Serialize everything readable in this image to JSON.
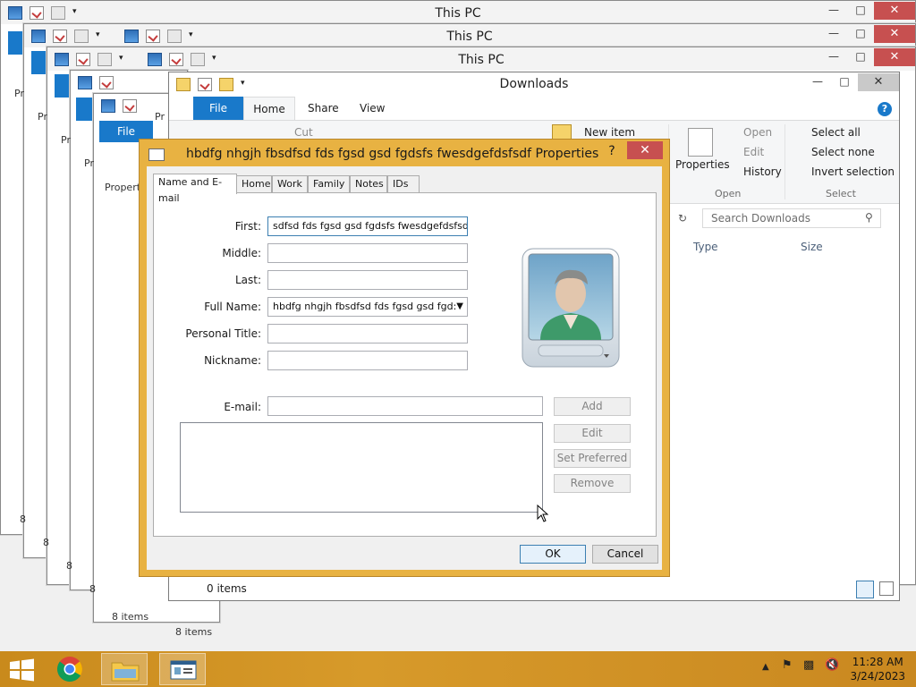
{
  "background_windows": [
    {
      "title": "This PC"
    },
    {
      "title": "This PC"
    },
    {
      "title": "This PC"
    }
  ],
  "fragments": {
    "pr1": "Pr",
    "pr2": "Pr",
    "pr3": "Pr",
    "pr4": "Pr",
    "pr5": "Pr",
    "n1": "8",
    "n2": "8",
    "n3": "8",
    "n4": "8",
    "file_tab": "File",
    "propert": "Propert",
    "items_8": "8 items",
    "items_8b": "8 items"
  },
  "downloads": {
    "title": "Downloads",
    "tabs": [
      "File",
      "Home",
      "Share",
      "View"
    ],
    "ribbon": {
      "cut": "Cut",
      "new_item": "New item",
      "open": "Open",
      "edit": "Edit",
      "history": "History",
      "properties": "Properties",
      "select_all": "Select all",
      "select_none": "Select none",
      "invert_selection": "Invert selection",
      "group_open": "Open",
      "group_select": "Select"
    },
    "search_placeholder": "Search Downloads",
    "columns": [
      "Type",
      "Size"
    ],
    "status": "0 items"
  },
  "dialog": {
    "title": "hbdfg nhgjh fbsdfsd fds fgsd gsd fgdsfs fwesdgefdsfsdf Properties",
    "help": "?",
    "tabs": [
      "Name and E-mail",
      "Home",
      "Work",
      "Family",
      "Notes",
      "IDs"
    ],
    "fields": {
      "first_label": "First:",
      "first_value": "sdfsd fds fgsd gsd fgdsfs fwesdgefdsfsdf",
      "middle_label": "Middle:",
      "middle_value": "",
      "last_label": "Last:",
      "last_value": "",
      "fullname_label": "Full Name:",
      "fullname_value": "hbdfg nhgjh fbsdfsd fds fgsd gsd fgd:",
      "title_label": "Personal Title:",
      "title_value": "",
      "nickname_label": "Nickname:",
      "nickname_value": "",
      "email_label": "E-mail:",
      "email_value": ""
    },
    "buttons": {
      "add": "Add",
      "edit": "Edit",
      "set_preferred": "Set Preferred",
      "remove": "Remove",
      "ok": "OK",
      "cancel": "Cancel"
    }
  },
  "taskbar": {
    "time": "11:28 AM",
    "date": "3/24/2023"
  },
  "colors": {
    "dialog_frame": "#e8b242",
    "taskbar": "#d79a2a",
    "ribbon_blue": "#1979ca",
    "close_red": "#c75050"
  }
}
